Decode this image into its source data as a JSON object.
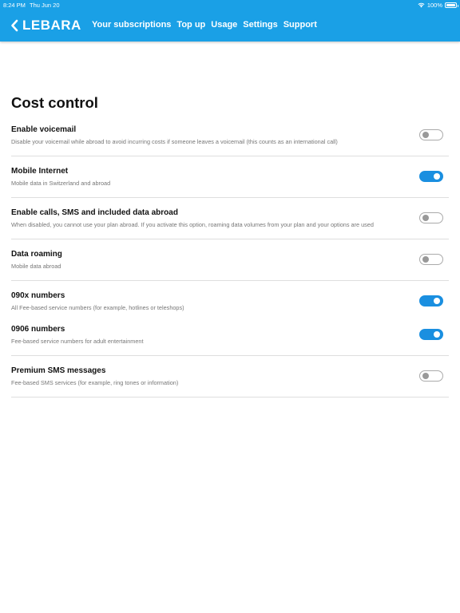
{
  "status_bar": {
    "time": "8:24 PM",
    "date": "Thu Jun 20",
    "battery": "100%"
  },
  "header": {
    "logo": "LEBARA",
    "nav": [
      "Your subscriptions",
      "Top up",
      "Usage",
      "Settings",
      "Support"
    ]
  },
  "page": {
    "title": "Cost control"
  },
  "settings": [
    {
      "title": "Enable voicemail",
      "description": "Disable your voicemail while abroad to avoid incurring costs if someone leaves a voicemail (this counts as an international call)",
      "enabled": false
    },
    {
      "title": "Mobile Internet",
      "description": "Mobile data in Switzerland and abroad",
      "enabled": true
    },
    {
      "title": "Enable calls, SMS and included data abroad",
      "description": "When disabled, you cannot use your plan abroad. If you activate this option, roaming data volumes from your plan and your options are used",
      "enabled": false
    },
    {
      "title": "Data roaming",
      "description": "Mobile data abroad",
      "enabled": false
    },
    {
      "title": "090x numbers",
      "description": "All Fee-based service numbers (for example, hotlines or teleshops)",
      "enabled": true
    },
    {
      "title": "0906 numbers",
      "description": "Fee-based service numbers for adult entertainment",
      "enabled": true
    },
    {
      "title": "Premium SMS messages",
      "description": "Fee-based SMS services (for example, ring tones or information)",
      "enabled": false
    }
  ],
  "colors": {
    "header_bg": "#1aa0e6",
    "toggle_on": "#1a8fe0",
    "toggle_off_border": "#aaaaaa"
  }
}
